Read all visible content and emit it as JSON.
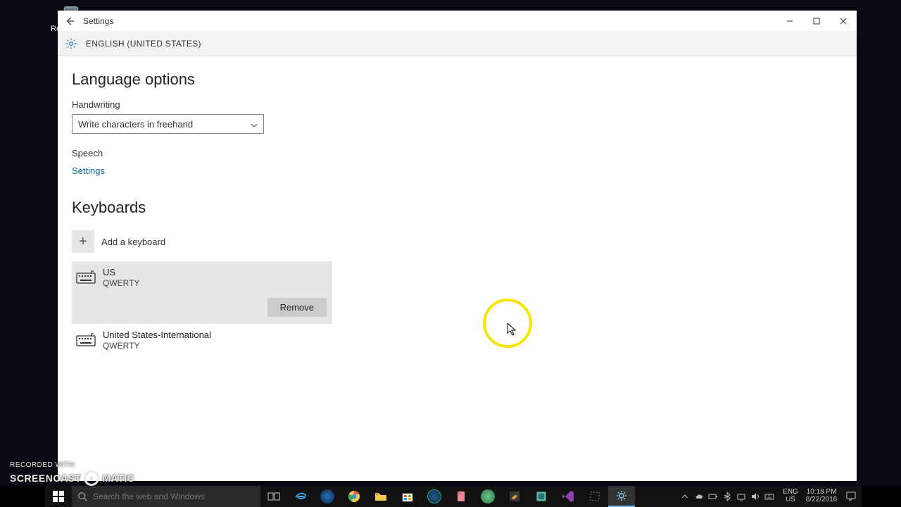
{
  "desktop": {
    "recycle_bin_label": "Recycle Bin"
  },
  "window": {
    "title": "Settings",
    "breadcrumb": "ENGLISH (UNITED STATES)"
  },
  "language_options": {
    "heading": "Language options",
    "handwriting_label": "Handwriting",
    "handwriting_selected": "Write characters in freehand",
    "speech_label": "Speech",
    "speech_link": "Settings"
  },
  "keyboards": {
    "heading": "Keyboards",
    "add_label": "Add a keyboard",
    "items": [
      {
        "name": "US",
        "layout": "QWERTY",
        "selected": true
      },
      {
        "name": "United States-International",
        "layout": "QWERTY",
        "selected": false
      }
    ],
    "remove_label": "Remove"
  },
  "taskbar": {
    "search_placeholder": "Search the web and Windows",
    "lang_code": "ENG",
    "lang_region": "US",
    "time": "10:18 PM",
    "date": "8/22/2016"
  },
  "watermark": {
    "line1": "RECORDED WITH",
    "brand_a": "SCREENCAST",
    "brand_b": "MATIC"
  }
}
